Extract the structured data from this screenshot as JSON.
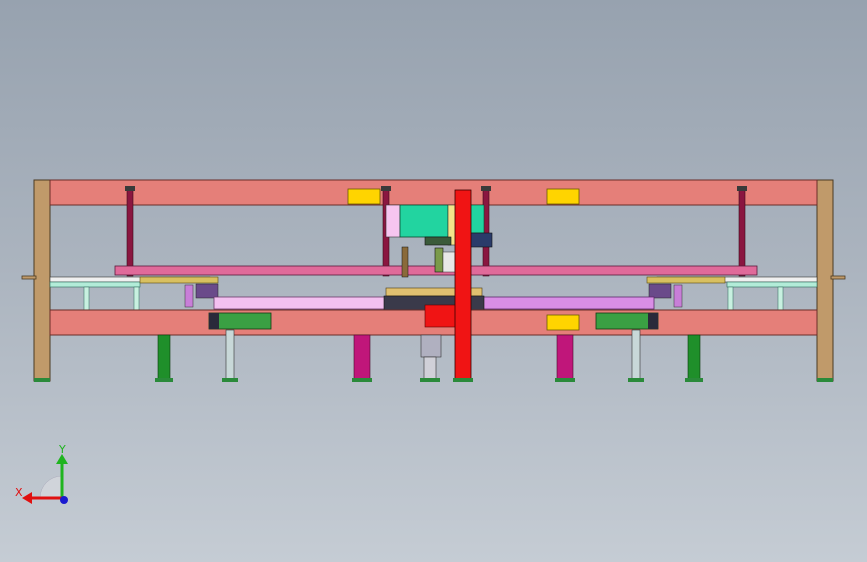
{
  "viewport": {
    "background_top": "#97a2af",
    "background_bottom": "#c5ccd4"
  },
  "triad": {
    "x_label": "X",
    "y_label": "Y",
    "x_color": "#e01010",
    "y_color": "#1fb41f",
    "z_color": "#1a1ad0"
  },
  "colors": {
    "wood": "#c09a6a",
    "beam": "#e57f79",
    "yellow_plate": "#ffd400",
    "red_column": "#f01414",
    "magenta_leg": "#c0167a",
    "green_leg": "#1f8f2a",
    "pink_rail": "#f3c0f0",
    "violet_rail": "#d98ee6",
    "cyan_block": "#22d4a0",
    "dark_green_box": "#3aa043"
  }
}
